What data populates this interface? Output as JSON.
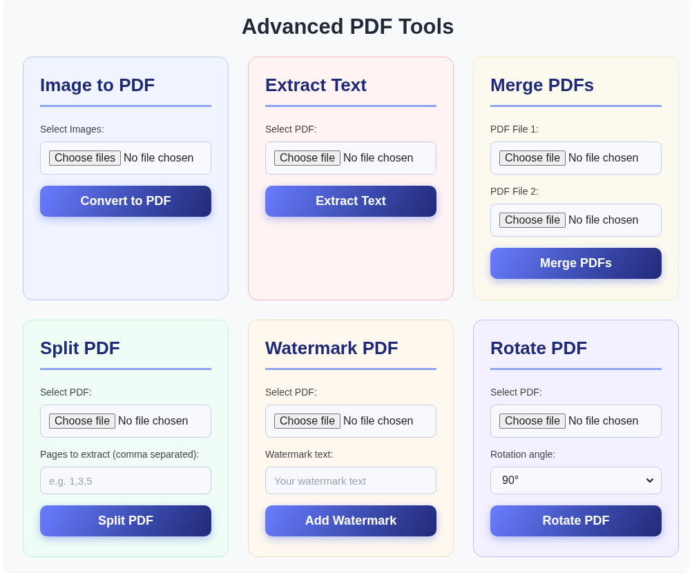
{
  "title": "Advanced PDF Tools",
  "cards": [
    {
      "heading": "Image to PDF",
      "color": "#f0f4ff",
      "fields": [
        {
          "kind": "file",
          "label": "Select Images:",
          "button": "Choose files",
          "status": "No file chosen"
        }
      ],
      "action": "Convert to PDF"
    },
    {
      "heading": "Extract Text",
      "color": "#fff3f4",
      "fields": [
        {
          "kind": "file",
          "label": "Select PDF:",
          "button": "Choose file",
          "status": "No file chosen"
        }
      ],
      "action": "Extract Text"
    },
    {
      "heading": "Merge PDFs",
      "color": "#fcf9ef",
      "fields": [
        {
          "kind": "file",
          "label": "PDF File 1:",
          "button": "Choose file",
          "status": "No file chosen"
        },
        {
          "kind": "file",
          "label": "PDF File 2:",
          "button": "Choose file",
          "status": "No file chosen"
        }
      ],
      "action": "Merge PDFs"
    },
    {
      "heading": "Split PDF",
      "color": "#effdf6",
      "fields": [
        {
          "kind": "file",
          "label": "Select PDF:",
          "button": "Choose file",
          "status": "No file chosen"
        },
        {
          "kind": "text",
          "label": "Pages to extract (comma separated):",
          "placeholder": "e.g. 1,3,5"
        }
      ],
      "action": "Split PDF"
    },
    {
      "heading": "Watermark PDF",
      "color": "#fff8ef",
      "fields": [
        {
          "kind": "file",
          "label": "Select PDF:",
          "button": "Choose file",
          "status": "No file chosen"
        },
        {
          "kind": "text",
          "label": "Watermark text:",
          "placeholder": "Your watermark text"
        }
      ],
      "action": "Add Watermark"
    },
    {
      "heading": "Rotate PDF",
      "color": "#f3f0ff",
      "fields": [
        {
          "kind": "file",
          "label": "Select PDF:",
          "button": "Choose file",
          "status": "No file chosen"
        },
        {
          "kind": "select",
          "label": "Rotation angle:",
          "value": "90°"
        }
      ],
      "action": "Rotate PDF"
    }
  ]
}
